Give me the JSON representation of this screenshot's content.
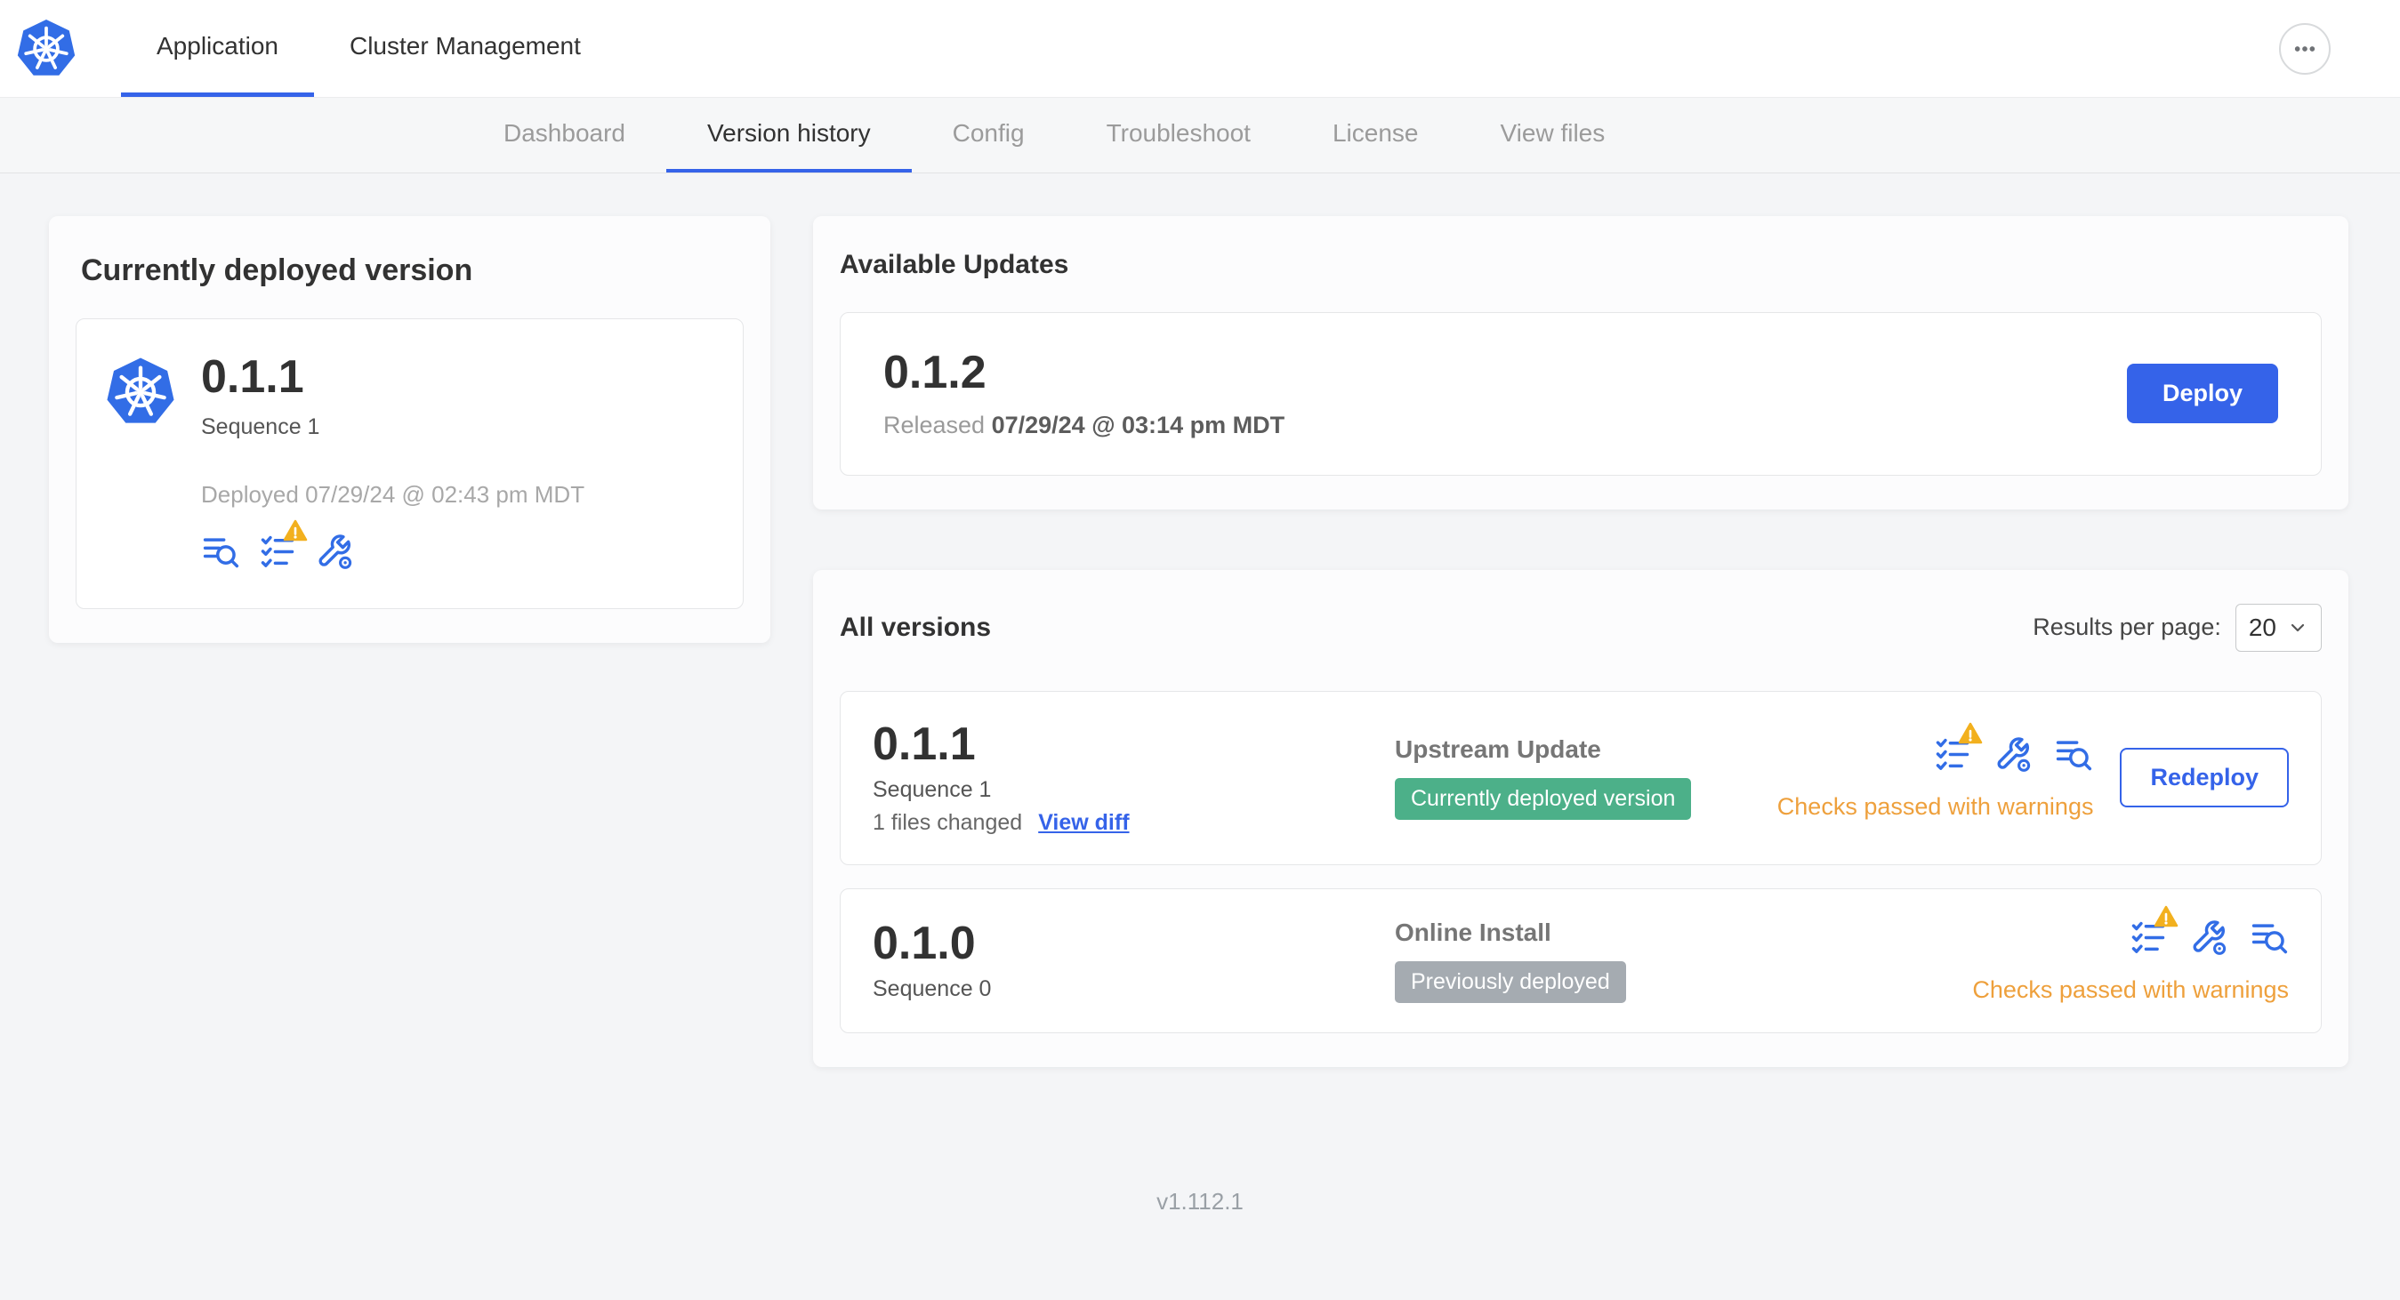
{
  "colors": {
    "accent_blue": "#3563e9",
    "icon_blue": "#326de6",
    "warning_orange": "#eea03c",
    "badge_green": "#4cb089",
    "badge_gray": "#a5abb1"
  },
  "icons": {
    "brand": "kubernetes-logo",
    "top_right": "ellipsis-icon",
    "version_icons": [
      "preflight-checks-icon",
      "edit-config-icon",
      "view-logs-icon"
    ],
    "warning_overlay": "warning-triangle-icon",
    "select_chevron": "chevron-down-icon"
  },
  "header": {
    "tabs": [
      {
        "label": "Application"
      },
      {
        "label": "Cluster Management"
      }
    ]
  },
  "subnav": {
    "active": "Version history",
    "items": [
      {
        "label": "Dashboard"
      },
      {
        "label": "Version history"
      },
      {
        "label": "Config"
      },
      {
        "label": "Troubleshoot"
      },
      {
        "label": "License"
      },
      {
        "label": "View files"
      }
    ]
  },
  "deployed_card": {
    "title": "Currently deployed version",
    "version": "0.1.1",
    "sequence": "Sequence 1",
    "deployed_at": "Deployed 07/29/24 @ 02:43 pm MDT"
  },
  "available_updates": {
    "title": "Available Updates",
    "version": "0.1.2",
    "released_label": "Released",
    "released_at": "07/29/24 @ 03:14 pm MDT",
    "deploy_button": "Deploy"
  },
  "all_versions": {
    "title": "All versions",
    "results_per_page_label": "Results per page:",
    "results_per_page_value": "20",
    "rows": [
      {
        "version": "0.1.1",
        "sequence": "Sequence 1",
        "files_changed": "1 files changed",
        "view_diff": "View diff",
        "source_type": "Upstream Update",
        "badge_label": "Currently deployed version",
        "badge_type": "green",
        "status_text": "Checks passed with warnings",
        "action_button": "Redeploy"
      },
      {
        "version": "0.1.0",
        "sequence": "Sequence 0",
        "source_type": "Online Install",
        "badge_label": "Previously deployed",
        "badge_type": "gray",
        "status_text": "Checks passed with warnings"
      }
    ]
  },
  "footer": {
    "app_version": "v1.112.1"
  }
}
